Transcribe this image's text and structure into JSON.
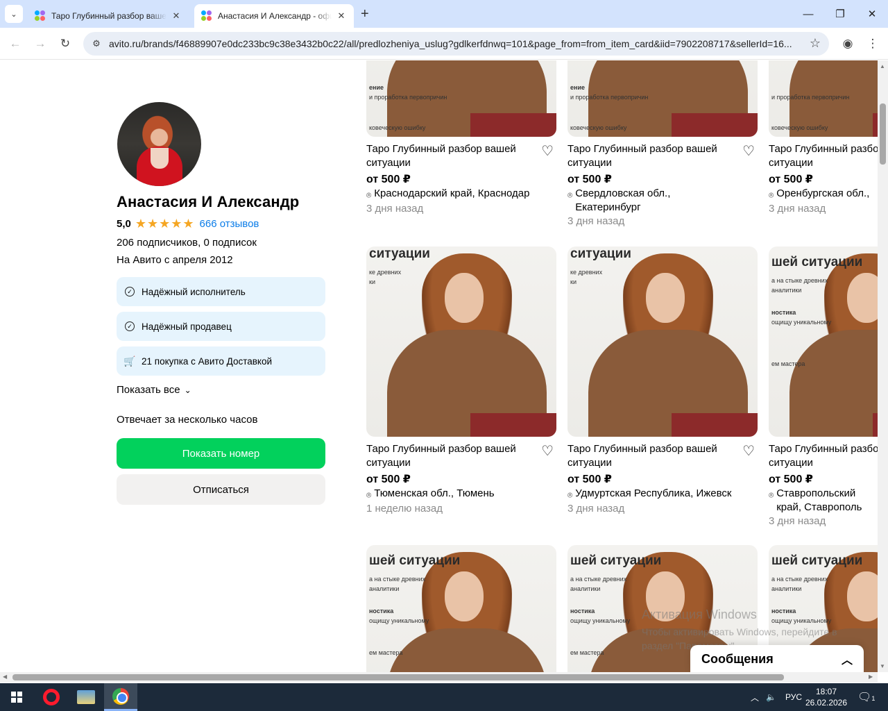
{
  "browser": {
    "tabs": [
      {
        "title": "Таро Глубинный разбор вашей ситуации",
        "active": false
      },
      {
        "title": "Анастасия И Александр - официальный",
        "active": true
      }
    ],
    "url": "avito.ru/brands/f46889907e0dc233bc9c38e3432b0c22/all/predlozheniya_uslug?gdlkerfdnwq=101&page_from=from_item_card&iid=7902208717&sellerId=16..."
  },
  "profile": {
    "name": "Анастасия И Александр",
    "rating": "5,0",
    "stars": "★★★★★",
    "reviews": "666 отзывов",
    "subscribers": "206 подписчиков, 0 подписок",
    "since": "На Авито с апреля 2012",
    "badges": [
      {
        "icon": "check-circle",
        "label": "Надёжный исполнитель"
      },
      {
        "icon": "check-circle",
        "label": "Надёжный продавец"
      },
      {
        "icon": "cart",
        "label": "21 покупка с Авито Доставкой"
      }
    ],
    "show_all": "Показать все",
    "responds": "Отвечает за несколько часов",
    "show_phone": "Показать номер",
    "unsubscribe": "Отписаться"
  },
  "listings": [
    {
      "title": "Таро Глубинный разбор вашей ситуации",
      "price": "от 500 ₽",
      "location": "Краснодарский край, Краснодар",
      "date": "3 дня назад"
    },
    {
      "title": "Таро Глубинный разбор вашей ситуации",
      "price": "от 500 ₽",
      "location": "Свердловская обл., Екатеринбург",
      "date": "3 дня назад"
    },
    {
      "title": "Таро Глубинный разбор вашей ситуации",
      "price": "от 500 ₽",
      "location": "Оренбургская обл.,",
      "date": "3 дня назад"
    },
    {
      "title": "Таро Глубинный разбор вашей ситуации",
      "price": "от 500 ₽",
      "location": "Тюменская обл., Тюмень",
      "date": "1 неделю назад",
      "img_heading": "ситуации"
    },
    {
      "title": "Таро Глубинный разбор вашей ситуации",
      "price": "от 500 ₽",
      "location": "Удмуртская Республика, Ижевск",
      "date": "3 дня назад",
      "img_heading": "ситуации"
    },
    {
      "title": "Таро Глубинный разбор вашей ситуации",
      "price": "от 500 ₽",
      "location": "Ставропольский край, Ставрополь",
      "date": "3 дня назад",
      "img_heading": "шей ситуации"
    },
    {
      "img_heading": "шей ситуации"
    },
    {
      "img_heading": "шей ситуации"
    },
    {
      "img_heading": "шей ситуации"
    }
  ],
  "image_texts": {
    "line_a": "ке древних",
    "line_b": "ки",
    "line_c": "а на стыке древних",
    "line_d": "аналитики",
    "line_e": "ностика",
    "line_f": "ощищу уникальному",
    "line_g": "ем мастера",
    "line_h": "ение",
    "line_i": "и проработка первопричин",
    "line_j": "ковеческую ошибку"
  },
  "messages_widget": {
    "label": "Сообщения"
  },
  "watermark": {
    "title": "Активация Windows",
    "text": "Чтобы активировать Windows, перейдите в раздел \"Параметры\"."
  },
  "taskbar": {
    "lang": "РУС",
    "time": "18:07",
    "date": "26.02.2026",
    "notif_count": "1"
  },
  "colors": {
    "primary_button": "#02d15c",
    "link": "#0a7ce8",
    "badge_bg": "#e6f4fd",
    "star": "#f5a623"
  }
}
